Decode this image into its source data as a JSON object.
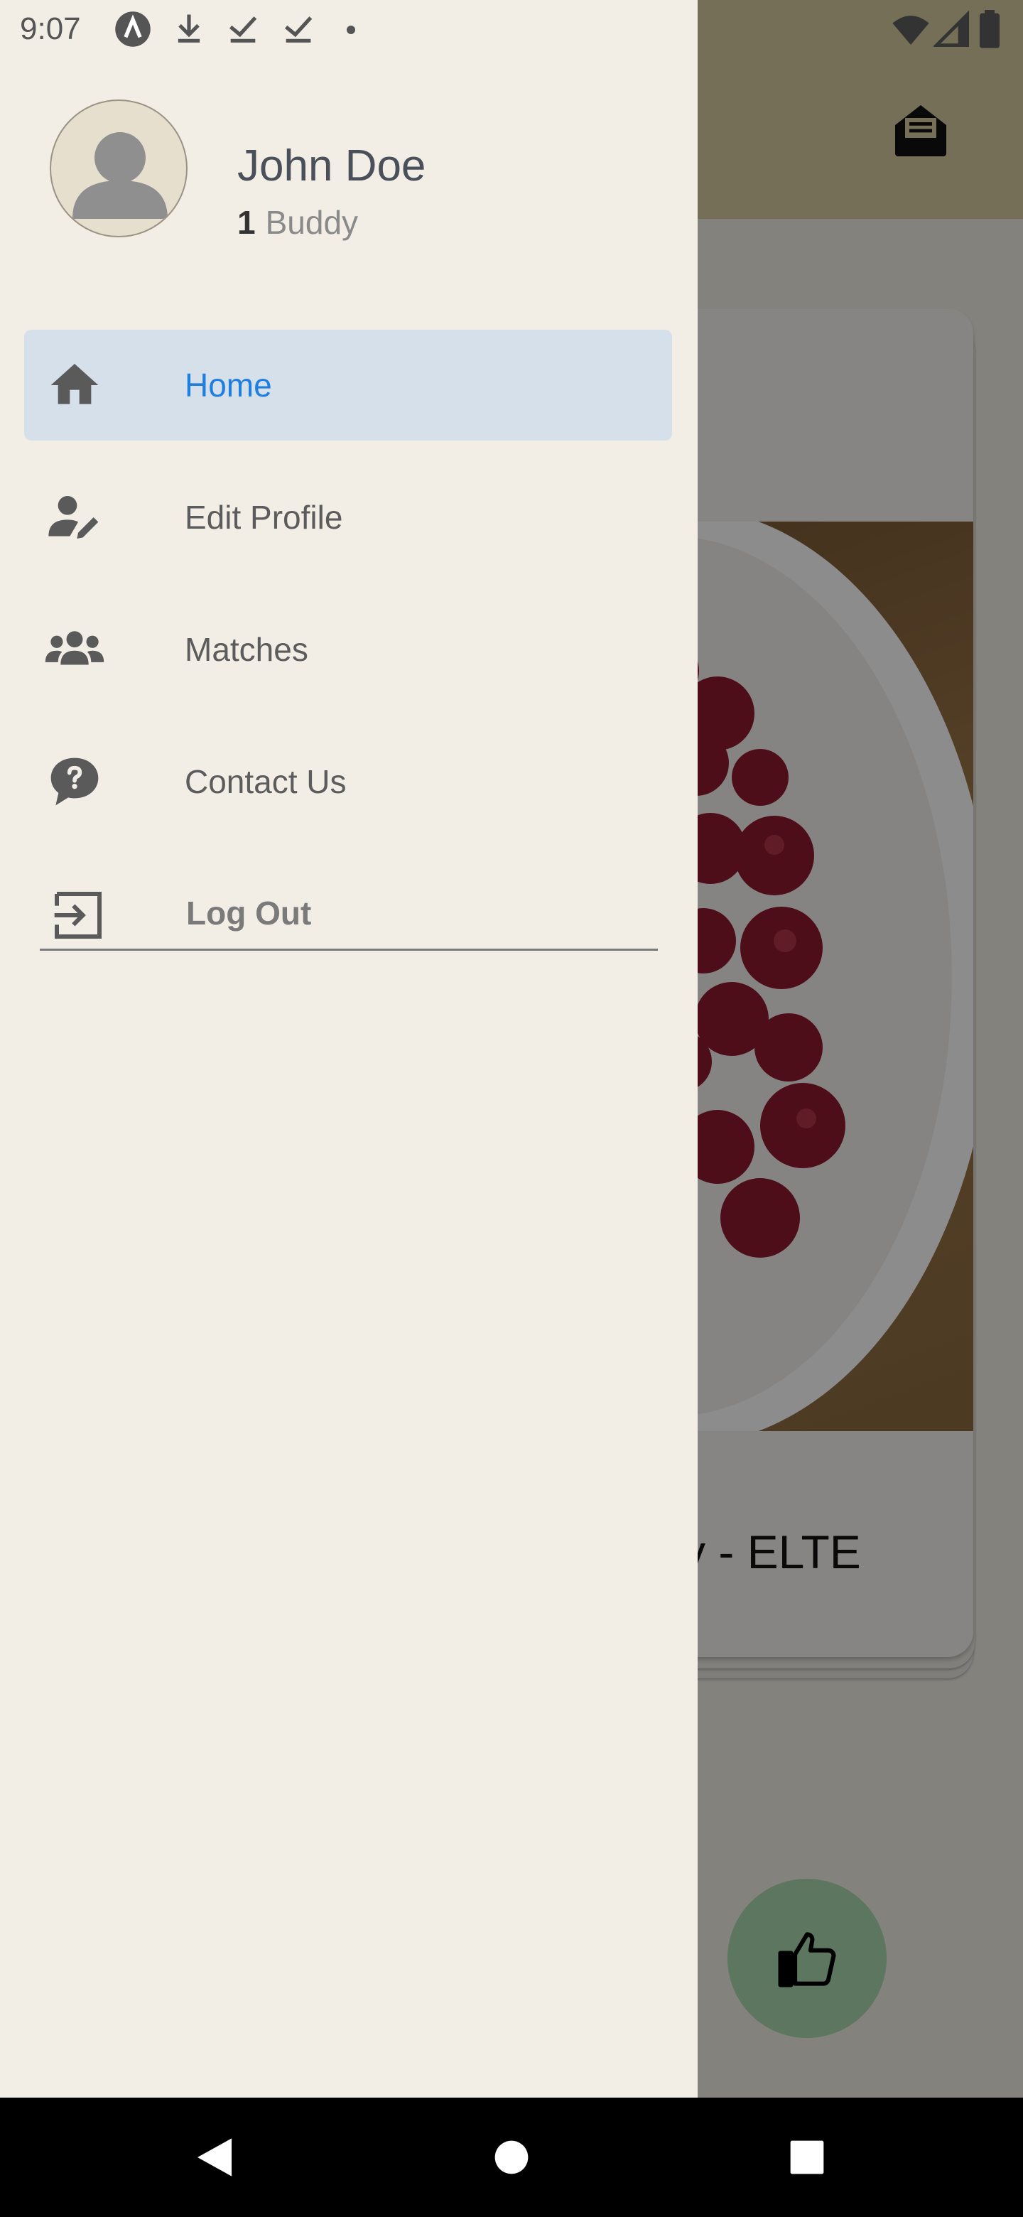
{
  "status_bar": {
    "time": "9:07",
    "icons": [
      "app-notification-icon",
      "download-icon",
      "check-download-icon",
      "check-download-icon",
      "dot-icon",
      "wifi-icon",
      "signal-icon",
      "battery-icon"
    ]
  },
  "drawer": {
    "user": {
      "name": "John Doe",
      "buddy_count": "1",
      "buddy_label": "Buddy"
    },
    "items": [
      {
        "label": "Home",
        "icon": "home-icon",
        "active": true
      },
      {
        "label": "Edit Profile",
        "icon": "edit-profile-icon",
        "active": false
      },
      {
        "label": "Matches",
        "icon": "group-icon",
        "active": false
      },
      {
        "label": "Contact Us",
        "icon": "question-chat-icon",
        "active": false
      }
    ],
    "logout_label": "Log Out"
  },
  "background": {
    "card_title": "y - ELTE"
  },
  "colors": {
    "accent": "#1f7fe0",
    "drawer_bg": "#f2eee6",
    "active_item_bg": "#d6e0ea",
    "like_button": "#a8d8b0"
  }
}
